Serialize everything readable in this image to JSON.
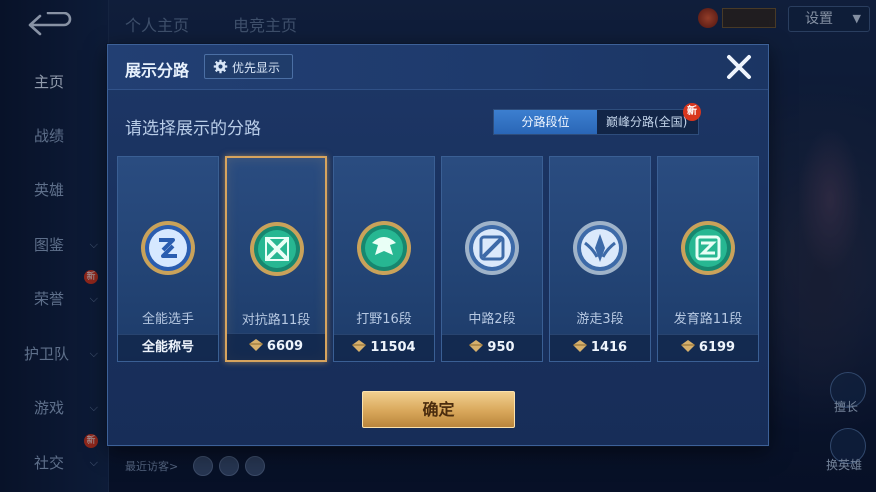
{
  "background": {
    "top_tabs": [
      "个人主页",
      "电竞主页"
    ],
    "settings_label": "设置",
    "nav_items": [
      {
        "label": "主页",
        "has_chevron": false,
        "badge": ""
      },
      {
        "label": "战绩",
        "has_chevron": false,
        "badge": ""
      },
      {
        "label": "英雄",
        "has_chevron": false,
        "badge": ""
      },
      {
        "label": "图鉴",
        "has_chevron": true,
        "badge": ""
      },
      {
        "label": "荣誉",
        "has_chevron": true,
        "badge": "新"
      },
      {
        "label": "护卫队",
        "has_chevron": true,
        "badge": ""
      },
      {
        "label": "游戏",
        "has_chevron": true,
        "badge": ""
      },
      {
        "label": "社交",
        "has_chevron": true,
        "badge": "新"
      }
    ],
    "recent_visitors_label": "最近访客>",
    "side_labels": [
      "擅长",
      "换英雄"
    ]
  },
  "modal": {
    "title": "展示分路",
    "priority_button": "优先显示",
    "subtitle": "请选择展示的分路",
    "segments": [
      "分路段位",
      "巅峰分路(全国)"
    ],
    "segment_badge": "新",
    "confirm_label": "确定",
    "lanes": [
      {
        "name": "全能选手",
        "footer": "全能称号",
        "score": "",
        "icon": "all-round-emblem-icon",
        "selected": false
      },
      {
        "name": "对抗路11段",
        "footer": "6609",
        "score": "6609",
        "icon": "clash-lane-emblem-icon",
        "selected": true
      },
      {
        "name": "打野16段",
        "footer": "11504",
        "score": "11504",
        "icon": "jungle-emblem-icon",
        "selected": false
      },
      {
        "name": "中路2段",
        "footer": "950",
        "score": "950",
        "icon": "mid-lane-emblem-icon",
        "selected": false
      },
      {
        "name": "游走3段",
        "footer": "1416",
        "score": "1416",
        "icon": "roam-emblem-icon",
        "selected": false
      },
      {
        "name": "发育路11段",
        "footer": "6199",
        "score": "6199",
        "icon": "farm-lane-emblem-icon",
        "selected": false
      }
    ]
  },
  "colors": {
    "accent_blue": "#2f6fc2",
    "gold": "#d7a45e",
    "emblem_teal": "#1fa588"
  }
}
